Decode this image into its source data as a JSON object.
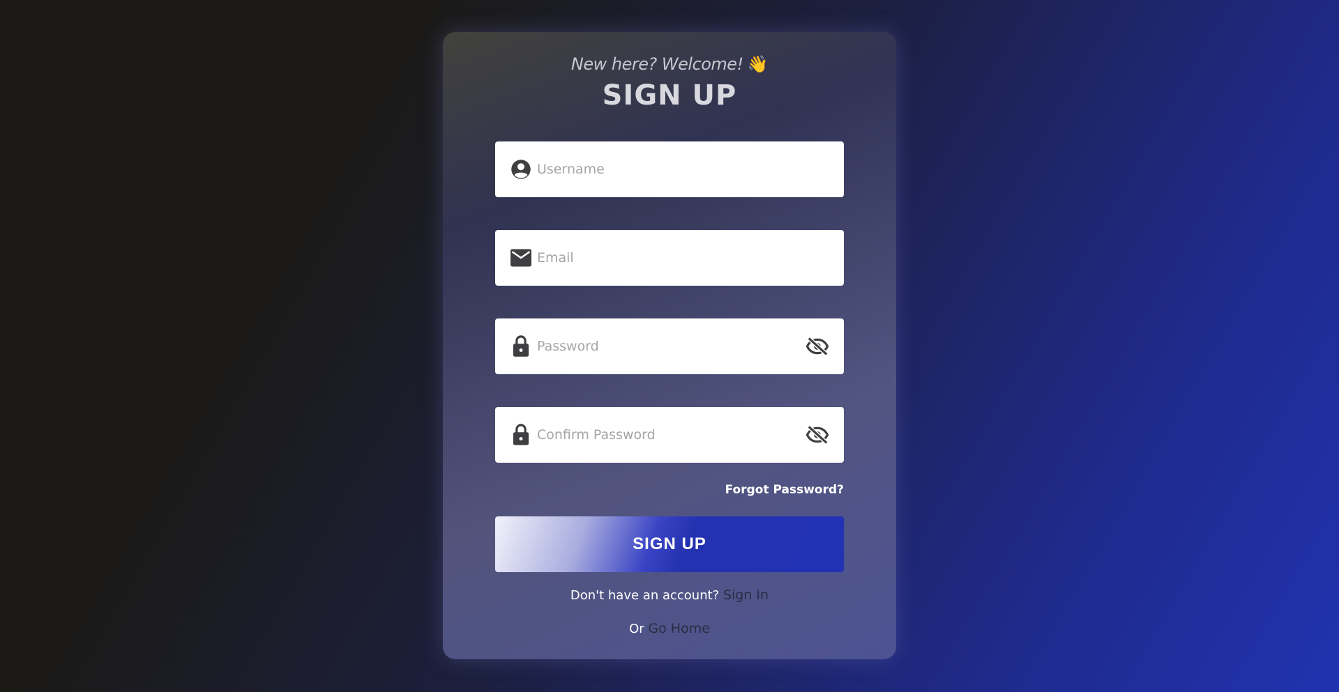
{
  "header": {
    "welcome": "New here? Welcome!",
    "wave_emoji": "👋",
    "title": "SIGN UP"
  },
  "form": {
    "username": {
      "placeholder": "Username",
      "value": "",
      "icon": "user-circle-icon"
    },
    "email": {
      "placeholder": "Email",
      "value": "",
      "icon": "envelope-icon"
    },
    "password": {
      "placeholder": "Password",
      "value": "",
      "icon": "lock-icon",
      "toggle_icon": "eye-slash-icon"
    },
    "confirm_password": {
      "placeholder": "Confirm Password",
      "value": "",
      "icon": "lock-icon",
      "toggle_icon": "eye-slash-icon"
    },
    "forgot_label": "Forgot Password?",
    "submit_label": "SIGN UP"
  },
  "footer": {
    "account_prompt": "Don't have an account?",
    "sign_in_label": "Sign In",
    "or_text": "Or",
    "go_home_label": "Go Home"
  },
  "colors": {
    "icon": "#3f3f42",
    "button_primary": "#2332b0",
    "link_dark": "#2a2d45"
  }
}
